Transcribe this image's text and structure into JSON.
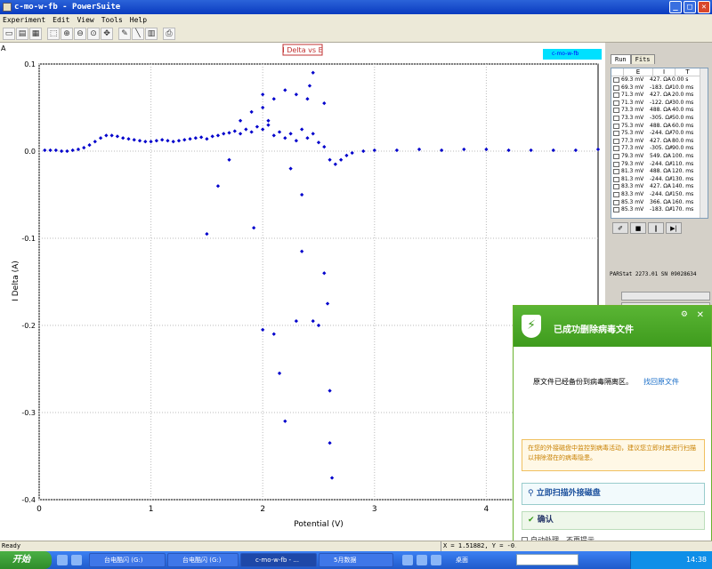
{
  "window": {
    "title": "c-mo-w-fb - PowerSuite",
    "minimize": "_",
    "maximize": "□",
    "close": "✕"
  },
  "menu": [
    "Experiment",
    "Edit",
    "View",
    "Tools",
    "Help"
  ],
  "toolbar_icons": [
    "new-icon",
    "open-icon",
    "save-icon",
    "select-icon",
    "zoom-in-icon",
    "zoom-out-icon",
    "zoom-all-icon",
    "move-icon",
    "pen-icon",
    "line-icon",
    "chart-icon",
    "export-icon"
  ],
  "chart_data": {
    "type": "scatter",
    "title": "I Delta vs E",
    "xlabel": "Potential (V)",
    "ylabel": "I Delta (A)",
    "xlim": [
      0,
      5
    ],
    "ylim": [
      -0.4,
      0.1
    ],
    "xticks": [
      "0",
      "1",
      "2",
      "3",
      "4"
    ],
    "yticks": [
      "0.1",
      "0.0",
      "-0.1",
      "-0.2",
      "-0.3",
      "-0.4"
    ],
    "grid": true,
    "legend_location": "top-right",
    "series": [
      {
        "name": "c-mo-w-fb",
        "color": "#0000cc",
        "x": [
          0.05,
          0.1,
          0.15,
          0.2,
          0.25,
          0.3,
          0.35,
          0.4,
          0.45,
          0.5,
          0.55,
          0.6,
          0.65,
          0.7,
          0.75,
          0.8,
          0.85,
          0.9,
          0.95,
          1.0,
          1.05,
          1.1,
          1.15,
          1.2,
          1.25,
          1.3,
          1.35,
          1.4,
          1.45,
          1.5,
          1.55,
          1.6,
          1.65,
          1.7,
          1.75,
          1.8,
          1.85,
          1.9,
          1.95,
          2.0,
          2.05,
          2.1,
          2.15,
          2.2,
          2.25,
          2.3,
          2.35,
          2.4,
          2.45,
          2.5,
          2.55,
          2.6,
          2.65,
          2.7,
          2.75,
          2.8,
          2.9,
          3.0,
          3.2,
          3.4,
          3.6,
          3.8,
          4.0,
          4.2,
          4.4,
          4.6,
          4.8,
          5.0,
          1.5,
          1.92,
          2.0,
          2.1,
          2.15,
          2.2,
          2.3,
          2.35,
          2.45,
          2.5,
          2.55,
          2.58,
          2.6,
          2.6,
          2.62,
          2.0,
          2.1,
          2.2,
          2.3,
          2.4,
          2.45,
          2.55,
          1.6,
          1.7,
          1.8,
          1.9,
          2.0,
          2.05,
          2.25,
          2.35,
          2.42
        ],
        "y": [
          0.001,
          0.001,
          0.001,
          0.0,
          0.0,
          0.001,
          0.002,
          0.004,
          0.007,
          0.011,
          0.015,
          0.018,
          0.018,
          0.017,
          0.015,
          0.014,
          0.013,
          0.012,
          0.011,
          0.011,
          0.012,
          0.013,
          0.012,
          0.011,
          0.012,
          0.013,
          0.014,
          0.015,
          0.016,
          0.014,
          0.017,
          0.018,
          0.02,
          0.021,
          0.023,
          0.02,
          0.025,
          0.022,
          0.028,
          0.025,
          0.03,
          0.018,
          0.022,
          0.015,
          0.02,
          0.012,
          0.025,
          0.015,
          0.02,
          0.01,
          0.005,
          -0.01,
          -0.015,
          -0.01,
          -0.005,
          -0.002,
          0.0,
          0.001,
          0.001,
          0.002,
          0.001,
          0.002,
          0.002,
          0.001,
          0.001,
          0.001,
          0.001,
          0.002,
          -0.095,
          -0.088,
          -0.205,
          -0.21,
          -0.255,
          -0.31,
          -0.195,
          -0.115,
          -0.195,
          -0.2,
          -0.14,
          -0.175,
          -0.275,
          -0.335,
          -0.375,
          0.065,
          0.06,
          0.07,
          0.065,
          0.06,
          0.09,
          0.055,
          -0.04,
          -0.01,
          0.035,
          0.045,
          0.05,
          0.035,
          -0.02,
          -0.05,
          0.075
        ]
      }
    ]
  },
  "run_table": {
    "tabs": [
      "Run",
      "Fits"
    ],
    "columns": [
      "E",
      "I",
      "T"
    ],
    "rows": [
      [
        "69.3 mV",
        "427. ΩA",
        "0.00 s"
      ],
      [
        "69.3 mV",
        "-183. ΩA",
        "10.0 ms"
      ],
      [
        "71.3 mV",
        "427. ΩA",
        "20.0 ms"
      ],
      [
        "71.3 mV",
        "-122. ΩA",
        "30.0 ms"
      ],
      [
        "73.3 mV",
        "488. ΩA",
        "40.0 ms"
      ],
      [
        "73.3 mV",
        "-305. ΩA",
        "50.0 ms"
      ],
      [
        "75.3 mV",
        "488. ΩA",
        "60.0 ms"
      ],
      [
        "75.3 mV",
        "-244. ΩA",
        "70.0 ms"
      ],
      [
        "77.3 mV",
        "427. ΩA",
        "80.0 ms"
      ],
      [
        "77.3 mV",
        "-305. ΩA",
        "90.0 ms"
      ],
      [
        "79.3 mV",
        "549. ΩA",
        "100. ms"
      ],
      [
        "79.3 mV",
        "-244. ΩA",
        "110. ms"
      ],
      [
        "81.3 mV",
        "488. ΩA",
        "120. ms"
      ],
      [
        "81.3 mV",
        "-244. ΩA",
        "130. ms"
      ],
      [
        "83.3 mV",
        "427. ΩA",
        "140. ms"
      ],
      [
        "83.3 mV",
        "-244. ΩA",
        "150. ms"
      ],
      [
        "85.3 mV",
        "366. ΩA",
        "160. ms"
      ],
      [
        "85.3 mV",
        "-183. ΩA",
        "170. ms"
      ]
    ]
  },
  "instrument": {
    "serial": "PARStat 2273.01 SN 09028634",
    "gauge_labels": [
      "I",
      "E"
    ]
  },
  "popup": {
    "title": "已成功删除病毒文件",
    "message": "原文件已经备份到病毒隔离区。",
    "link": "找回原文件",
    "warning": "在您的外接磁盘中监控到病毒活动，建议您立即对其进行扫描以排除潜在的病毒隐患。",
    "scan_button": "立即扫描外接磁盘",
    "ok_button": "确认",
    "auto_checkbox": "自动处理，不再提示"
  },
  "status": {
    "left": "Ready",
    "coords": "X = 1.51882, Y = -0.08"
  },
  "taskbar": {
    "start": "开始",
    "tasks": [
      "台电酷闪 (G:)",
      "台电酷闪 (G:)",
      "c-mo-w-fb - ...",
      "5月数据"
    ],
    "desktop": "桌面",
    "clock": "14:38"
  }
}
